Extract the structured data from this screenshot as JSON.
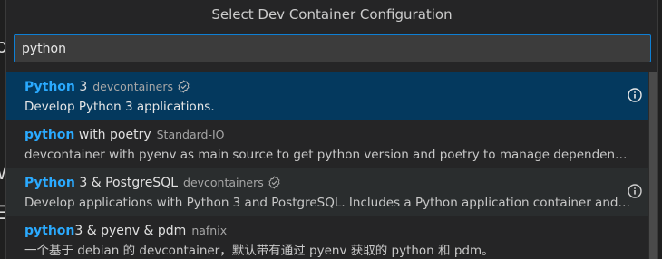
{
  "dialog": {
    "title": "Select Dev Container Configuration"
  },
  "search": {
    "value": "python"
  },
  "background": {
    "glyphs": [
      "c",
      "W",
      "E"
    ]
  },
  "items": [
    {
      "highlight": "Python",
      "rest": " 3",
      "publisher": "devcontainers",
      "verified": true,
      "description": "Develop Python 3 applications.",
      "info_icon": true,
      "selected": true
    },
    {
      "highlight": "python",
      "rest": " with poetry",
      "publisher": "Standard-IO",
      "verified": false,
      "description": "devcontainer with pyenv as main source to get python version and poetry to manage dependencies",
      "info_icon": false,
      "selected": false
    },
    {
      "highlight": "Python",
      "rest": " 3 & PostgreSQL",
      "publisher": "devcontainers",
      "verified": true,
      "description": "Develop applications with Python 3 and PostgreSQL. Includes a Python application container and PostgreSQL server",
      "info_icon": true,
      "selected": false
    },
    {
      "highlight": "python",
      "rest": "3 & pyenv & pdm",
      "publisher": "nafnix",
      "verified": false,
      "description": "一个基于 debian 的 devcontainer，默认带有通过 pyenv 获取的 python 和 pdm。",
      "info_icon": false,
      "selected": false
    }
  ],
  "colors": {
    "accent": "#2aaaff",
    "selection": "#04395e",
    "focus_border": "#0e7fd4",
    "panel": "#252526"
  },
  "icons": {
    "verified": "verified-badge-icon",
    "info": "info-icon"
  }
}
